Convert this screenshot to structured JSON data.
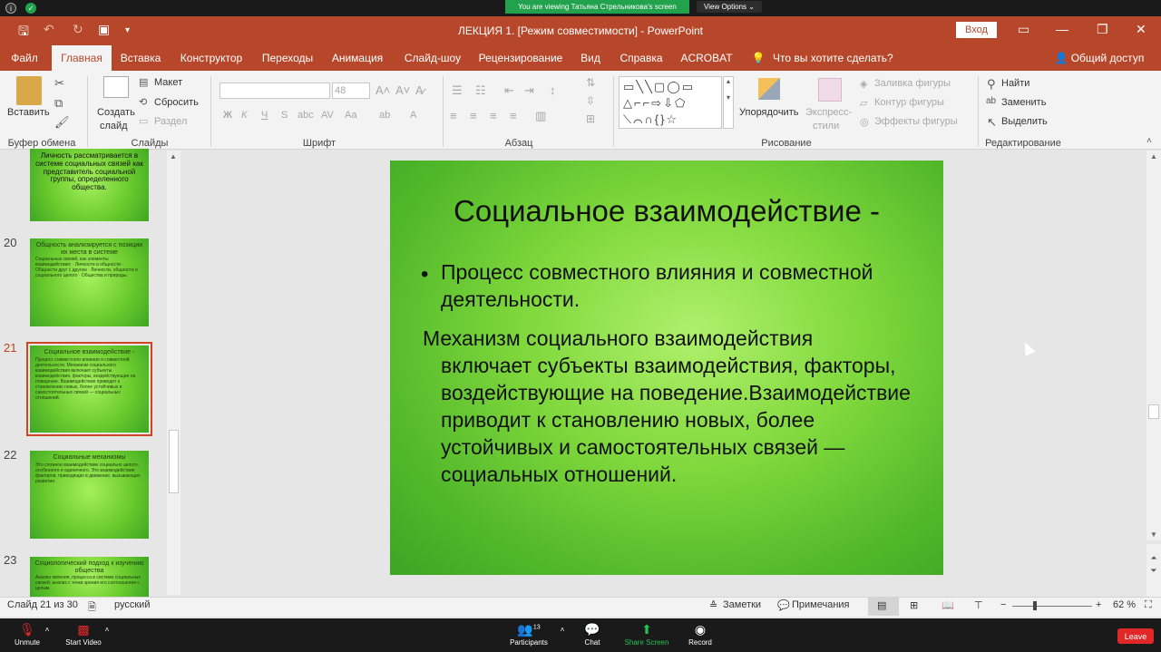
{
  "zoom": {
    "share_banner": "You are viewing Татьяна Стрельникова's screen",
    "view_options": "View Options ⌄",
    "bottom": [
      {
        "label": "Unmute",
        "icon": "mic-muted-icon"
      },
      {
        "label": "Start Video",
        "icon": "video-off-icon"
      },
      {
        "label": "Participants",
        "icon": "participants-icon",
        "count": "13"
      },
      {
        "label": "Chat",
        "icon": "chat-icon"
      },
      {
        "label": "Share Screen",
        "icon": "share-screen-icon"
      },
      {
        "label": "Record",
        "icon": "record-icon"
      }
    ],
    "leave": "Leave"
  },
  "window": {
    "title": "ЛЕКЦИЯ 1.  [Режим совместимости]  -  PowerPoint",
    "login": "Вход"
  },
  "tabs": [
    "Файл",
    "Главная",
    "Вставка",
    "Конструктор",
    "Переходы",
    "Анимация",
    "Слайд-шоу",
    "Рецензирование",
    "Вид",
    "Справка",
    "ACROBAT"
  ],
  "tellme": "Что вы хотите сделать?",
  "share": "Общий доступ",
  "ribbon": {
    "paste": "Вставить",
    "clipboard": "Буфер обмена",
    "new_slide_1": "Создать",
    "new_slide_2": "слайд",
    "layout": "Макет",
    "reset": "Сбросить",
    "section": "Раздел",
    "slides": "Слайды",
    "font_size": "48",
    "font": "Шрифт",
    "paragraph": "Абзац",
    "arrange": "Упорядочить",
    "quick_styles_1": "Экспресс-",
    "quick_styles_2": "стили",
    "shape_fill": "Заливка фигуры",
    "shape_outline": "Контур фигуры",
    "shape_effects": "Эффекты фигуры",
    "drawing": "Рисование",
    "find": "Найти",
    "replace": "Заменить",
    "select": "Выделить",
    "editing": "Редактирование"
  },
  "thumbnails": [
    {
      "num": "",
      "title": "Личность рассматривается в системе социальных связей как представитель социальной группы, определенного общества.",
      "body": ""
    },
    {
      "num": "20",
      "title": "Общность анализируется с позиции их места в системе",
      "body": "Социальных связей, как элементы взаимодействия: · Личности и общности · Общности друг с другом · Личности, общности и социального целого · Общества и природы."
    },
    {
      "num": "21",
      "title": "Социальное взаимодействие -",
      "body": "Процесс совместного влияния и совместной деятельности. Механизм социального взаимодействия включает субъекты взаимодействия, факторы, воздействующие на поведение. Взаимодействие приводит к становлению новых, более устойчивых и самостоятельных связей — социальных отношений."
    },
    {
      "num": "22",
      "title": "Социальные механизмы",
      "body": "Это сложное взаимодействие социально целого, особенного и единичного. Это взаимодействие факторов, приводящих в движение, вызывающих развитие."
    },
    {
      "num": "23",
      "title": "Социологический подход к изучению общества",
      "body": "Анализ явления, процесса в системе социальных связей; анализ с точки зрения его соотношения с целым."
    }
  ],
  "slide": {
    "title": "Социальное взаимодействие -",
    "bullet": "Процесс совместного влияния и совместной деятельности.",
    "para_first": "Механизм социального взаимодействия",
    "para_rest": "включает субъекты взаимодействия, факторы, воздействующие на поведение.Взаимодействие приводит к становлению новых, более устойчивых и самостоятельных связей — социальных отношений."
  },
  "status": {
    "slide_info": "Слайд 21 из 30",
    "language": "русский",
    "notes": "Заметки",
    "comments": "Примечания",
    "zoom": "62 %"
  },
  "colors": {
    "accent": "#b7472a",
    "zoom_green": "#23a24d",
    "leave": "#e02828"
  }
}
